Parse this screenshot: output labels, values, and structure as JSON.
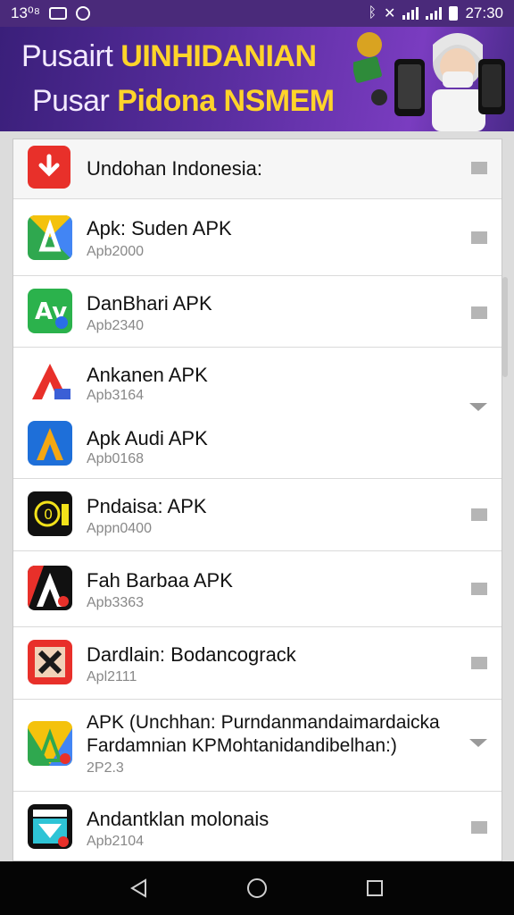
{
  "status_bar": {
    "time_left": "13⁰⁸",
    "time_right": "27:30"
  },
  "banner": {
    "line1_part1": "Pusairt ",
    "line1_part2": "UINHIDANIAN",
    "line2_part1": "Pusar ",
    "line2_part2": "Pidona NSMEM"
  },
  "header": {
    "title": "Undohan Indonesia:"
  },
  "apps": [
    {
      "name": "Apk: Suden APK",
      "sub": "Apb2000"
    },
    {
      "name": "DanBhari APK",
      "sub": "Apb2340"
    },
    {
      "name": "Ankanen APK",
      "sub": "Apb3164"
    },
    {
      "name": "Apk Audi APK",
      "sub": "Apb0168"
    },
    {
      "name": "Pndaisa: APK",
      "sub": "Appn0400"
    },
    {
      "name": "Fah Barbaa APK",
      "sub": "Apb3363"
    },
    {
      "name": "Dardlain: Bodancograck",
      "sub": "Apl2111"
    },
    {
      "name": "APK (Unchhan: Purndanmandaimardaicka",
      "name2": "Fardamnian KPMohtanidandibelhan:)",
      "sub": "2P2.3"
    },
    {
      "name": "Andantklan molonais",
      "sub": "Apb2104"
    }
  ],
  "colors": {
    "status_bar": "#4a2a7a",
    "banner_yellow": "#ffd42a",
    "nav_bar": "#050505"
  }
}
